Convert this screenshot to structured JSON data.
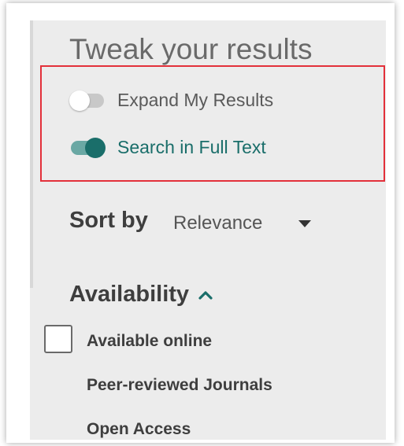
{
  "panel": {
    "title": "Tweak your results"
  },
  "toggles": [
    {
      "label": "Expand My Results",
      "state": "off"
    },
    {
      "label": "Search in Full Text",
      "state": "on"
    }
  ],
  "sort": {
    "label": "Sort by",
    "selected": "Relevance",
    "icon": "caret-down-icon"
  },
  "availability": {
    "title": "Availability",
    "icon": "chevron-up-icon",
    "options": [
      {
        "label": "Available online",
        "checked": false
      },
      {
        "label": "Peer-reviewed Journals"
      },
      {
        "label": "Open Access"
      }
    ]
  },
  "colors": {
    "accent": "#1a6e6a",
    "toggle_track_on": "#6aa8a4",
    "highlight": "#e3303a",
    "panel_bg": "#ececec"
  }
}
